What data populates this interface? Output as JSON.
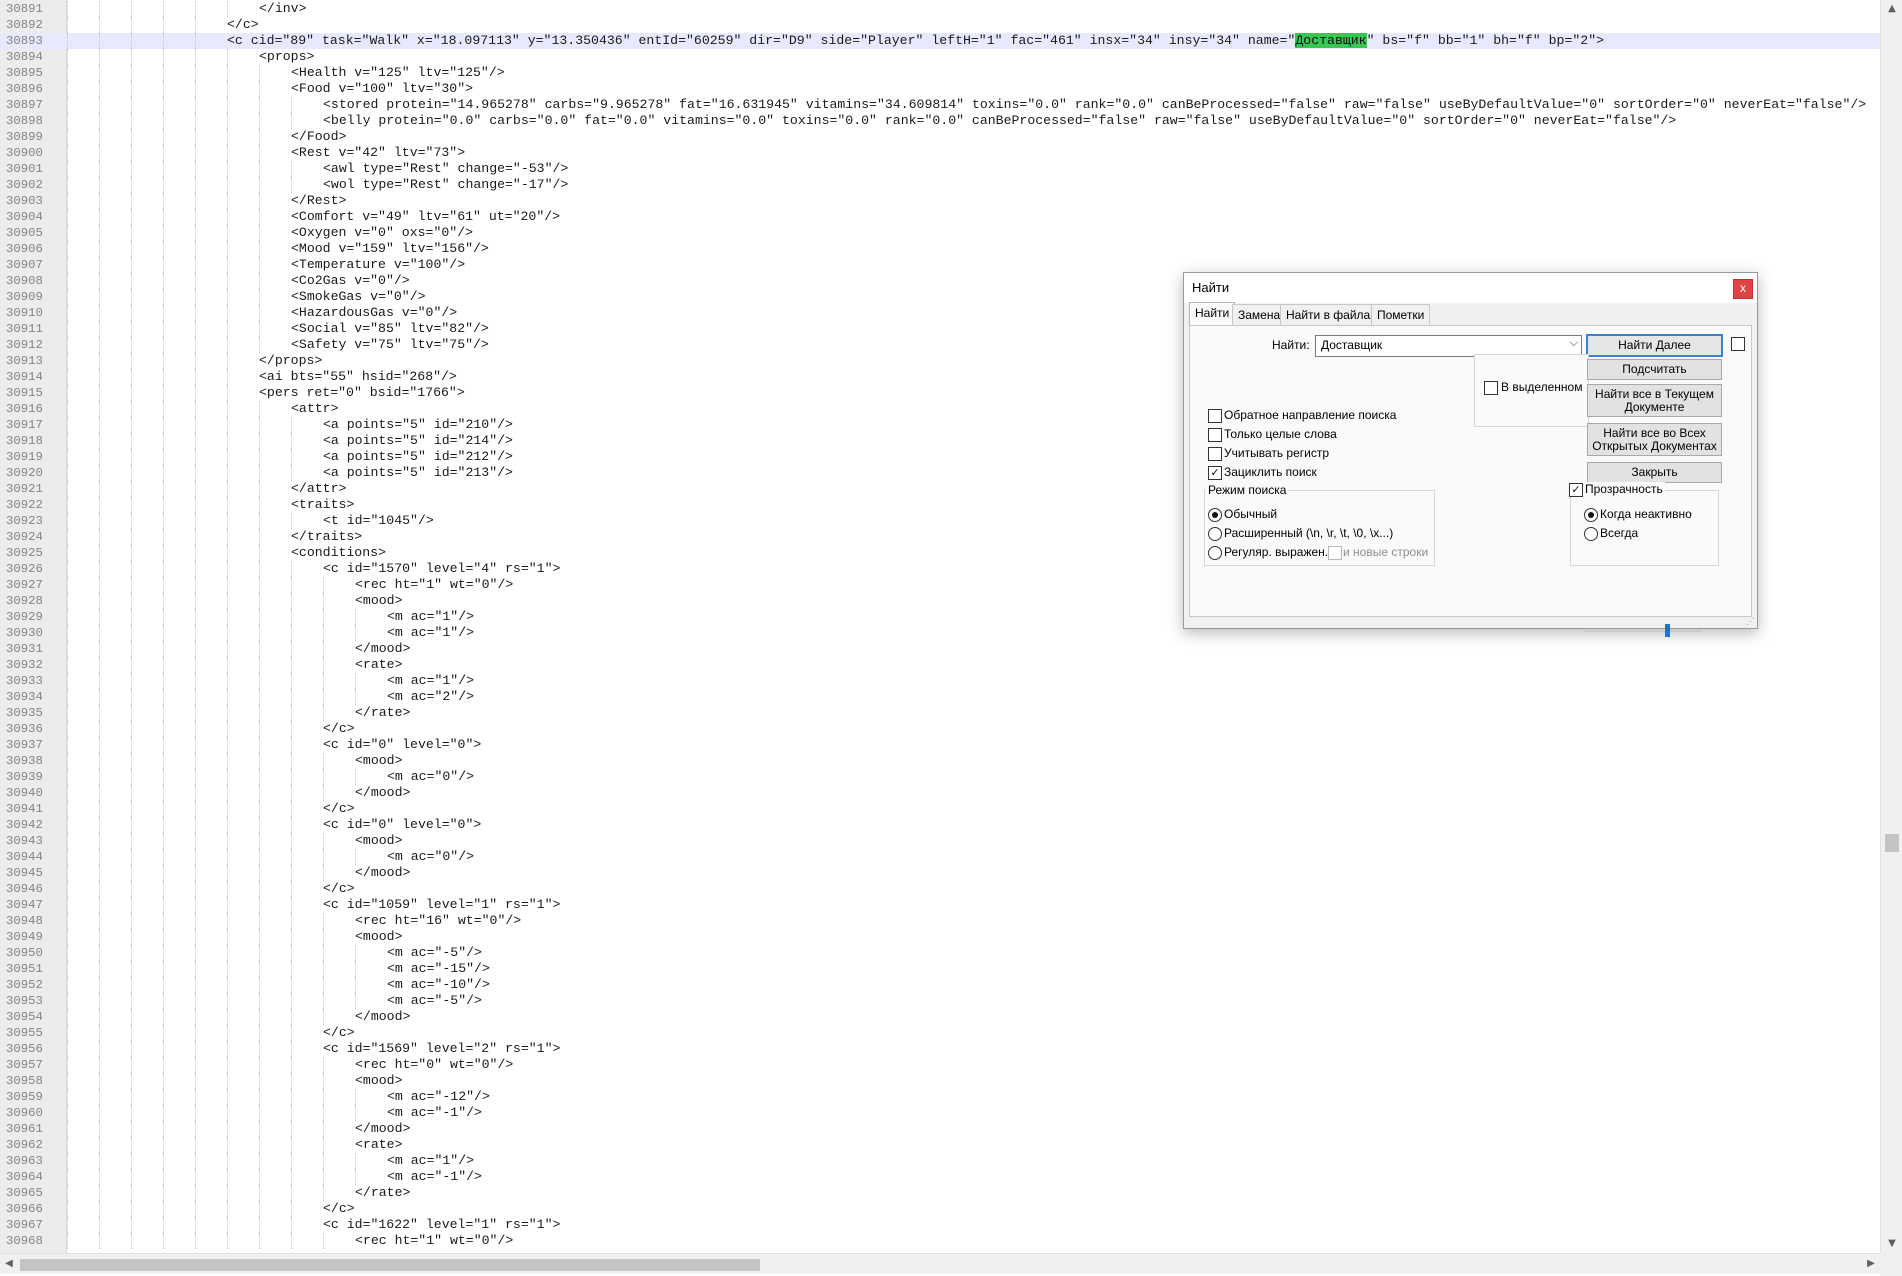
{
  "editor": {
    "first_line_number": 30891,
    "current_line_index": 2,
    "search_highlight": "Доставщик",
    "lines": [
      {
        "indent": 6,
        "text": "</inv>"
      },
      {
        "indent": 5,
        "text": "</c>"
      },
      {
        "indent": 5,
        "text": "<c cid=\"89\" task=\"Walk\" x=\"18.097113\" y=\"13.350436\" entId=\"60259\" dir=\"D9\" side=\"Player\" leftH=\"1\" fac=\"461\" insx=\"34\" insy=\"34\" name=\"Доставщик\" bs=\"f\" bb=\"1\" bh=\"f\" bp=\"2\">"
      },
      {
        "indent": 6,
        "text": "<props>"
      },
      {
        "indent": 7,
        "text": "<Health v=\"125\" ltv=\"125\"/>"
      },
      {
        "indent": 7,
        "text": "<Food v=\"100\" ltv=\"30\">"
      },
      {
        "indent": 8,
        "text": "<stored protein=\"14.965278\" carbs=\"9.965278\" fat=\"16.631945\" vitamins=\"34.609814\" toxins=\"0.0\" rank=\"0.0\" canBeProcessed=\"false\" raw=\"false\" useByDefaultValue=\"0\" sortOrder=\"0\" neverEat=\"false\"/>"
      },
      {
        "indent": 8,
        "text": "<belly protein=\"0.0\" carbs=\"0.0\" fat=\"0.0\" vitamins=\"0.0\" toxins=\"0.0\" rank=\"0.0\" canBeProcessed=\"false\" raw=\"false\" useByDefaultValue=\"0\" sortOrder=\"0\" neverEat=\"false\"/>"
      },
      {
        "indent": 7,
        "text": "</Food>"
      },
      {
        "indent": 7,
        "text": "<Rest v=\"42\" ltv=\"73\">"
      },
      {
        "indent": 8,
        "text": "<awl type=\"Rest\" change=\"-53\"/>"
      },
      {
        "indent": 8,
        "text": "<wol type=\"Rest\" change=\"-17\"/>"
      },
      {
        "indent": 7,
        "text": "</Rest>"
      },
      {
        "indent": 7,
        "text": "<Comfort v=\"49\" ltv=\"61\" ut=\"20\"/>"
      },
      {
        "indent": 7,
        "text": "<Oxygen v=\"0\" oxs=\"0\"/>"
      },
      {
        "indent": 7,
        "text": "<Mood v=\"159\" ltv=\"156\"/>"
      },
      {
        "indent": 7,
        "text": "<Temperature v=\"100\"/>"
      },
      {
        "indent": 7,
        "text": "<Co2Gas v=\"0\"/>"
      },
      {
        "indent": 7,
        "text": "<SmokeGas v=\"0\"/>"
      },
      {
        "indent": 7,
        "text": "<HazardousGas v=\"0\"/>"
      },
      {
        "indent": 7,
        "text": "<Social v=\"85\" ltv=\"82\"/>"
      },
      {
        "indent": 7,
        "text": "<Safety v=\"75\" ltv=\"75\"/>"
      },
      {
        "indent": 6,
        "text": "</props>"
      },
      {
        "indent": 6,
        "text": "<ai bts=\"55\" hsid=\"268\"/>"
      },
      {
        "indent": 6,
        "text": "<pers ret=\"0\" bsid=\"1766\">"
      },
      {
        "indent": 7,
        "text": "<attr>"
      },
      {
        "indent": 8,
        "text": "<a points=\"5\" id=\"210\"/>"
      },
      {
        "indent": 8,
        "text": "<a points=\"5\" id=\"214\"/>"
      },
      {
        "indent": 8,
        "text": "<a points=\"5\" id=\"212\"/>"
      },
      {
        "indent": 8,
        "text": "<a points=\"5\" id=\"213\"/>"
      },
      {
        "indent": 7,
        "text": "</attr>"
      },
      {
        "indent": 7,
        "text": "<traits>"
      },
      {
        "indent": 8,
        "text": "<t id=\"1045\"/>"
      },
      {
        "indent": 7,
        "text": "</traits>"
      },
      {
        "indent": 7,
        "text": "<conditions>"
      },
      {
        "indent": 8,
        "text": "<c id=\"1570\" level=\"4\" rs=\"1\">"
      },
      {
        "indent": 9,
        "text": "<rec ht=\"1\" wt=\"0\"/>"
      },
      {
        "indent": 9,
        "text": "<mood>"
      },
      {
        "indent": 10,
        "text": "<m ac=\"1\"/>"
      },
      {
        "indent": 10,
        "text": "<m ac=\"1\"/>"
      },
      {
        "indent": 9,
        "text": "</mood>"
      },
      {
        "indent": 9,
        "text": "<rate>"
      },
      {
        "indent": 10,
        "text": "<m ac=\"1\"/>"
      },
      {
        "indent": 10,
        "text": "<m ac=\"2\"/>"
      },
      {
        "indent": 9,
        "text": "</rate>"
      },
      {
        "indent": 8,
        "text": "</c>"
      },
      {
        "indent": 8,
        "text": "<c id=\"0\" level=\"0\">"
      },
      {
        "indent": 9,
        "text": "<mood>"
      },
      {
        "indent": 10,
        "text": "<m ac=\"0\"/>"
      },
      {
        "indent": 9,
        "text": "</mood>"
      },
      {
        "indent": 8,
        "text": "</c>"
      },
      {
        "indent": 8,
        "text": "<c id=\"0\" level=\"0\">"
      },
      {
        "indent": 9,
        "text": "<mood>"
      },
      {
        "indent": 10,
        "text": "<m ac=\"0\"/>"
      },
      {
        "indent": 9,
        "text": "</mood>"
      },
      {
        "indent": 8,
        "text": "</c>"
      },
      {
        "indent": 8,
        "text": "<c id=\"1059\" level=\"1\" rs=\"1\">"
      },
      {
        "indent": 9,
        "text": "<rec ht=\"16\" wt=\"0\"/>"
      },
      {
        "indent": 9,
        "text": "<mood>"
      },
      {
        "indent": 10,
        "text": "<m ac=\"-5\"/>"
      },
      {
        "indent": 10,
        "text": "<m ac=\"-15\"/>"
      },
      {
        "indent": 10,
        "text": "<m ac=\"-10\"/>"
      },
      {
        "indent": 10,
        "text": "<m ac=\"-5\"/>"
      },
      {
        "indent": 9,
        "text": "</mood>"
      },
      {
        "indent": 8,
        "text": "</c>"
      },
      {
        "indent": 8,
        "text": "<c id=\"1569\" level=\"2\" rs=\"1\">"
      },
      {
        "indent": 9,
        "text": "<rec ht=\"0\" wt=\"0\"/>"
      },
      {
        "indent": 9,
        "text": "<mood>"
      },
      {
        "indent": 10,
        "text": "<m ac=\"-12\"/>"
      },
      {
        "indent": 10,
        "text": "<m ac=\"-1\"/>"
      },
      {
        "indent": 9,
        "text": "</mood>"
      },
      {
        "indent": 9,
        "text": "<rate>"
      },
      {
        "indent": 10,
        "text": "<m ac=\"1\"/>"
      },
      {
        "indent": 10,
        "text": "<m ac=\"-1\"/>"
      },
      {
        "indent": 9,
        "text": "</rate>"
      },
      {
        "indent": 8,
        "text": "</c>"
      },
      {
        "indent": 8,
        "text": "<c id=\"1622\" level=\"1\" rs=\"1\">"
      },
      {
        "indent": 9,
        "text": "<rec ht=\"1\" wt=\"0\"/>"
      }
    ]
  },
  "find_dialog": {
    "title": "Найти",
    "close_label": "x",
    "tabs": [
      "Найти",
      "Замена",
      "Найти в файлах",
      "Пометки"
    ],
    "active_tab": 0,
    "find_label": "Найти:",
    "find_value": "Доставщик",
    "in_selection_label": "В выделенном",
    "buttons": {
      "find_next": "Найти Далее",
      "count": "Подсчитать",
      "find_all_current": "Найти все в Текущем Документе",
      "find_all_open": "Найти все во Всех Открытых Документах",
      "close": "Закрыть"
    },
    "options": [
      {
        "label": "Обратное направление поиска",
        "checked": false
      },
      {
        "label": "Только целые слова",
        "checked": false
      },
      {
        "label": "Учитывать регистр",
        "checked": false
      },
      {
        "label": "Зациклить поиск",
        "checked": true
      }
    ],
    "search_mode": {
      "title": "Режим поиска",
      "modes": [
        "Обычный",
        "Расширенный (\\n, \\r, \\t, \\0, \\x...)",
        "Регуляр. выражен."
      ],
      "selected": 0,
      "newline_label": "и новые строки"
    },
    "transparency": {
      "label": "Прозрачность",
      "checked": true,
      "options": [
        "Когда неактивно",
        "Всегда"
      ],
      "selected": 0,
      "level": 0.7
    }
  }
}
